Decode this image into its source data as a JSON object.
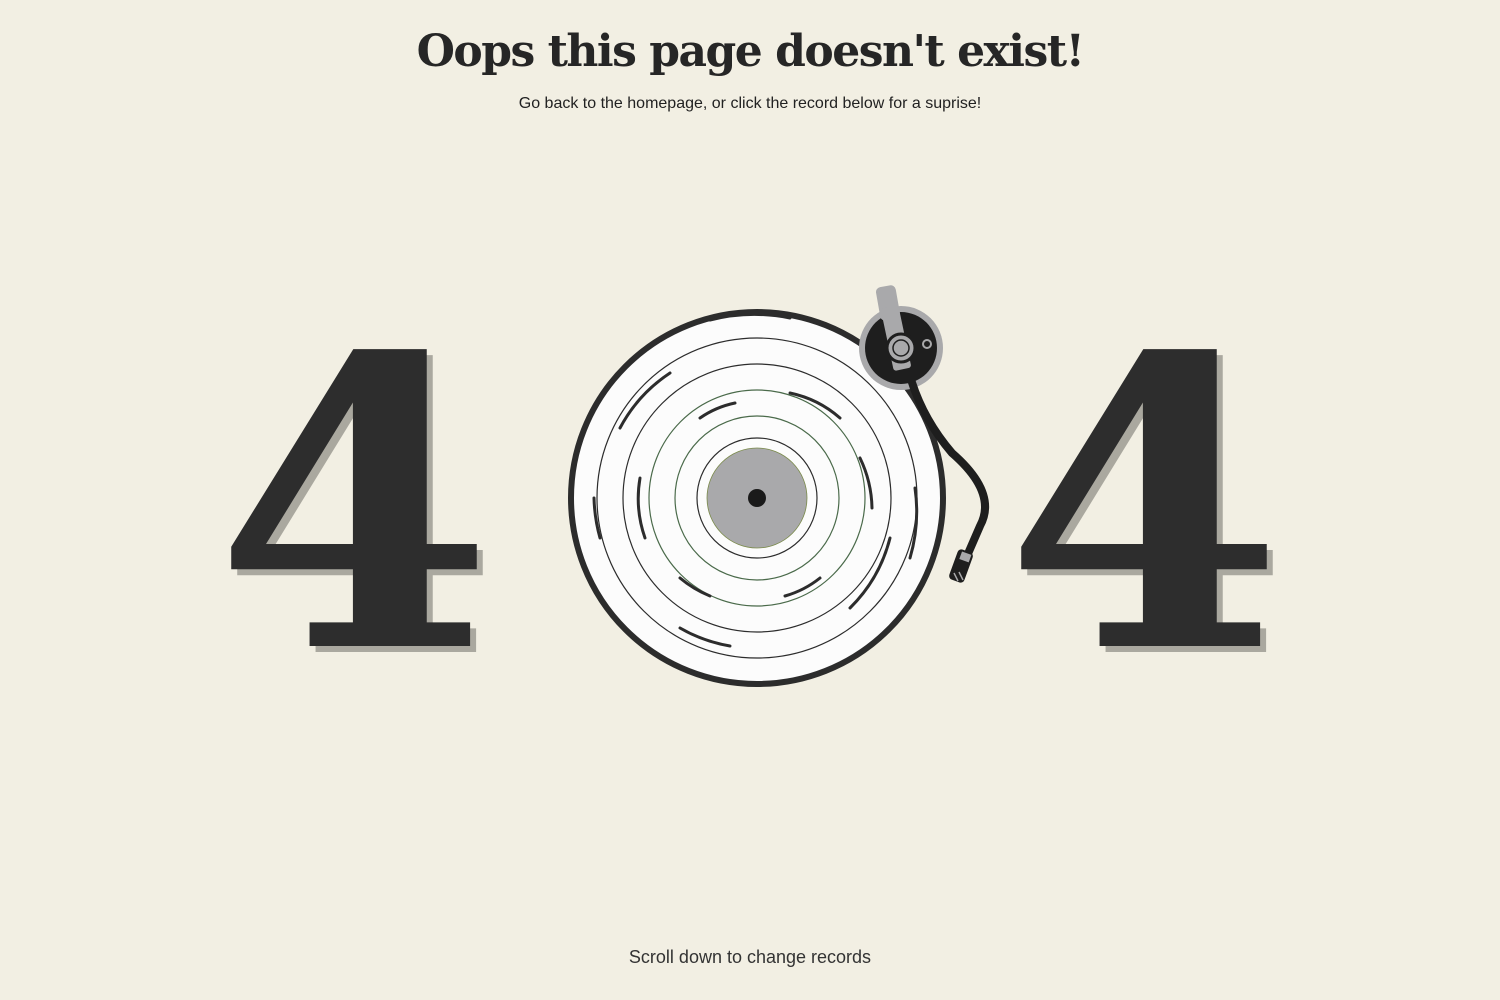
{
  "header": {
    "title": "Oops this page doesn't exist!",
    "subtitle": "Go back to the homepage, or click the record below for a suprise!"
  },
  "error_code": {
    "left_digit": "4",
    "right_digit": "4"
  },
  "record": {
    "icon": "vinyl-record-icon",
    "tonearm_icon": "tonearm-icon"
  },
  "footer": {
    "hint": "Scroll down to change records"
  },
  "colors": {
    "background": "#f2efe3",
    "digit": "#2d2d2d",
    "digit_shadow": "#aaa89f",
    "record_label": "#a9a9ab"
  }
}
